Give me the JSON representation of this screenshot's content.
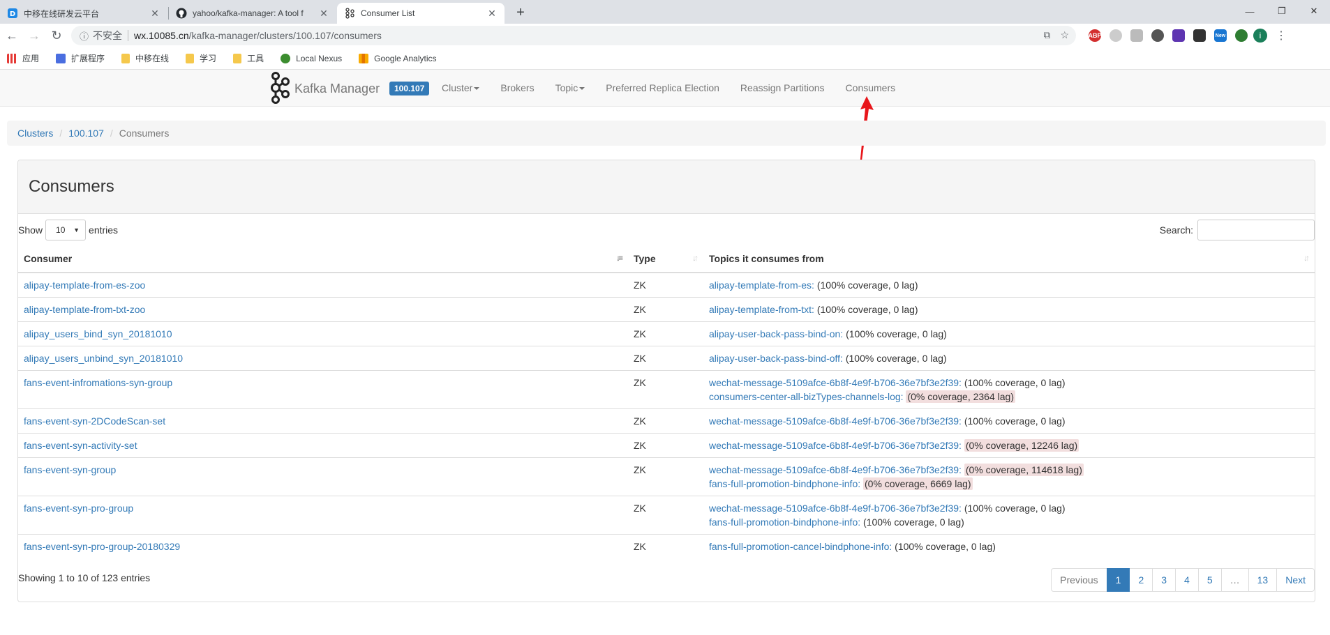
{
  "browser": {
    "tabs": [
      {
        "title": "中移在线研发云平台",
        "active": false,
        "icon": "d-logo-icon"
      },
      {
        "title": "yahoo/kafka-manager: A tool f",
        "active": false,
        "icon": "github-icon"
      },
      {
        "title": "Consumer List",
        "active": true,
        "icon": "kafka-icon"
      }
    ],
    "address": {
      "security_label": "不安全",
      "host": "wx.10085.cn",
      "path": "/kafka-manager/clusters/100.107/consumers"
    },
    "bookmarks": [
      {
        "label": "应用",
        "icon": "apps"
      },
      {
        "label": "扩展程序",
        "icon": "puzzle"
      },
      {
        "label": "中移在线",
        "icon": "folder"
      },
      {
        "label": "学习",
        "icon": "folder"
      },
      {
        "label": "工具",
        "icon": "folder"
      },
      {
        "label": "Local Nexus",
        "icon": "nexus"
      },
      {
        "label": "Google Analytics",
        "icon": "ga"
      }
    ],
    "avatar_letter": "i",
    "colors": {
      "tabbar": "#dee1e6",
      "omnibox": "#f1f3f4"
    }
  },
  "app": {
    "brand": "Kafka Manager",
    "cluster_badge": "100.107",
    "nav": [
      {
        "label": "Cluster",
        "dropdown": true
      },
      {
        "label": "Brokers",
        "dropdown": false
      },
      {
        "label": "Topic",
        "dropdown": true
      },
      {
        "label": "Preferred Replica Election",
        "dropdown": false
      },
      {
        "label": "Reassign Partitions",
        "dropdown": false
      },
      {
        "label": "Consumers",
        "dropdown": false
      }
    ],
    "breadcrumb": {
      "items": [
        "Clusters",
        "100.107"
      ],
      "current": "Consumers"
    },
    "panel_title": "Consumers",
    "length": {
      "prefix": "Show",
      "value": "10",
      "suffix": "entries"
    },
    "search_label": "Search:",
    "columns": [
      "Consumer",
      "Type",
      "Topics it consumes from"
    ],
    "rows": [
      {
        "consumer": "alipay-template-from-es-zoo",
        "type": "ZK",
        "topics": [
          {
            "name": "alipay-template-from-es:",
            "coverage": "(100% coverage, 0 lag)",
            "bad": false
          }
        ]
      },
      {
        "consumer": "alipay-template-from-txt-zoo",
        "type": "ZK",
        "topics": [
          {
            "name": "alipay-template-from-txt:",
            "coverage": "(100% coverage, 0 lag)",
            "bad": false
          }
        ]
      },
      {
        "consumer": "alipay_users_bind_syn_20181010",
        "type": "ZK",
        "topics": [
          {
            "name": "alipay-user-back-pass-bind-on:",
            "coverage": "(100% coverage, 0 lag)",
            "bad": false
          }
        ]
      },
      {
        "consumer": "alipay_users_unbind_syn_20181010",
        "type": "ZK",
        "topics": [
          {
            "name": "alipay-user-back-pass-bind-off:",
            "coverage": "(100% coverage, 0 lag)",
            "bad": false
          }
        ]
      },
      {
        "consumer": "fans-event-infromations-syn-group",
        "type": "ZK",
        "topics": [
          {
            "name": "wechat-message-5109afce-6b8f-4e9f-b706-36e7bf3e2f39:",
            "coverage": "(100% coverage, 0 lag)",
            "bad": false
          },
          {
            "name": "consumers-center-all-bizTypes-channels-log:",
            "coverage": "(0% coverage, 2364 lag)",
            "bad": true
          }
        ]
      },
      {
        "consumer": "fans-event-syn-2DCodeScan-set",
        "type": "ZK",
        "topics": [
          {
            "name": "wechat-message-5109afce-6b8f-4e9f-b706-36e7bf3e2f39:",
            "coverage": "(100% coverage, 0 lag)",
            "bad": false
          }
        ]
      },
      {
        "consumer": "fans-event-syn-activity-set",
        "type": "ZK",
        "topics": [
          {
            "name": "wechat-message-5109afce-6b8f-4e9f-b706-36e7bf3e2f39:",
            "coverage": "(0% coverage, 12246 lag)",
            "bad": true
          }
        ]
      },
      {
        "consumer": "fans-event-syn-group",
        "type": "ZK",
        "topics": [
          {
            "name": "wechat-message-5109afce-6b8f-4e9f-b706-36e7bf3e2f39:",
            "coverage": "(0% coverage, 114618 lag)",
            "bad": true
          },
          {
            "name": "fans-full-promotion-bindphone-info:",
            "coverage": "(0% coverage, 6669 lag)",
            "bad": true
          }
        ]
      },
      {
        "consumer": "fans-event-syn-pro-group",
        "type": "ZK",
        "topics": [
          {
            "name": "wechat-message-5109afce-6b8f-4e9f-b706-36e7bf3e2f39:",
            "coverage": "(100% coverage, 0 lag)",
            "bad": false
          },
          {
            "name": "fans-full-promotion-bindphone-info:",
            "coverage": "(100% coverage, 0 lag)",
            "bad": false
          }
        ]
      },
      {
        "consumer": "fans-event-syn-pro-group-20180329",
        "type": "ZK",
        "topics": [
          {
            "name": "fans-full-promotion-cancel-bindphone-info:",
            "coverage": "(100% coverage, 0 lag)",
            "bad": false
          }
        ]
      }
    ],
    "info": "Showing 1 to 10 of 123 entries",
    "pagination": [
      "Previous",
      "1",
      "2",
      "3",
      "4",
      "5",
      "…",
      "13",
      "Next"
    ],
    "active_page": "1",
    "colors": {
      "link": "#337ab7",
      "badge": "#337ab7",
      "lag_highlight": "#f2dede",
      "annotation_arrow": "#e8161b"
    }
  }
}
